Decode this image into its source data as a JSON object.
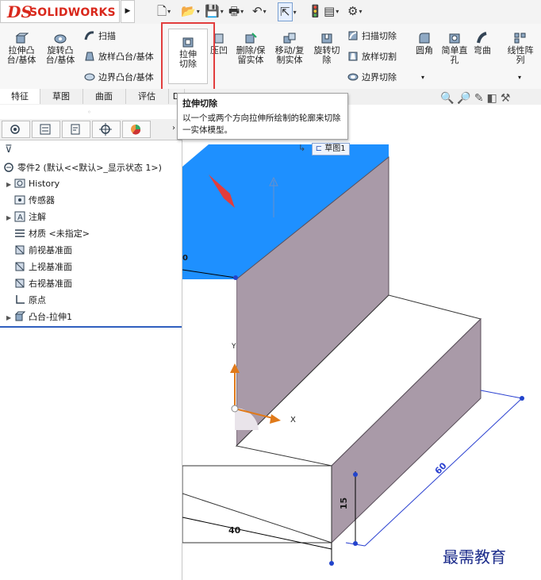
{
  "app": {
    "logo_ds": "DS",
    "logo_text": "SOLIDWORKS"
  },
  "ribbon": {
    "extrude_boss": "拉伸凸台/基体",
    "revolve_boss": "旋转凸台/基体",
    "sweep": "扫描",
    "loft_boss": "放样凸台/基体",
    "boundary_boss": "边界凸台/基体",
    "extrude_cut": "拉伸切除",
    "hole_wizard_short": "压凹",
    "delete_keep_body": "删除/保留实体",
    "move_copy_body": "移动/复制实体",
    "revolve_cut": "旋转切除",
    "sweep_cut": "扫描切除",
    "loft_cut": "放样切割",
    "boundary_cut": "边界切除",
    "fillet": "圆角",
    "simple_hole": "简单直孔",
    "flex": "弯曲",
    "linear_pattern": "线性阵列"
  },
  "tabs": [
    "特征",
    "草图",
    "曲面",
    "评估",
    "D"
  ],
  "tooltip": {
    "title": "拉伸切除",
    "description": "以一个或两个方向拉伸所绘制的轮廓来切除一实体模型。"
  },
  "tree": {
    "root": "零件2 (默认<<默认>_显示状态 1>)",
    "items": [
      "History",
      "传感器",
      "注解",
      "材质 <未指定>",
      "前视基准面",
      "上视基准面",
      "右视基准面",
      "原点",
      "凸台-拉伸1"
    ]
  },
  "viewport": {
    "sketch_tag": "草图1",
    "dim_40": "40",
    "dim_15": "15",
    "dim_60": "60",
    "dim_0": "0",
    "axis_x": "X",
    "axis_y": "Y"
  },
  "watermark": "最需教育",
  "colors": {
    "accent": "#1e90ff",
    "highlight_red": "#e23d3d",
    "solid_face": "#a99aa8",
    "top_face": "#1e90ff"
  }
}
